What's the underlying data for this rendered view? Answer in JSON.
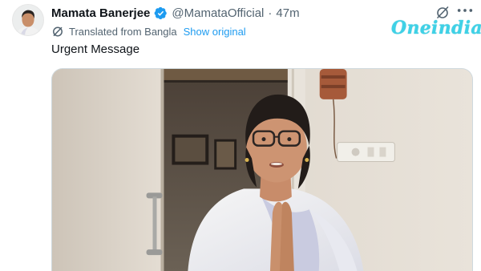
{
  "tweet": {
    "author": {
      "display_name": "Mamata Banerjee",
      "handle": "@MamataOfficial",
      "separator": "·",
      "time": "47m",
      "verified": true,
      "avatar_icon": "profile-photo"
    },
    "translation": {
      "icon": "translate-icon",
      "label": "Translated from Bangla",
      "link": "Show original"
    },
    "text": "Urgent Message",
    "media": {
      "type": "video-still"
    },
    "actions": {
      "grok_icon": "grok-icon",
      "more_icon": "more-options-icon"
    }
  },
  "watermark": {
    "text": "Oneindia"
  },
  "colors": {
    "link": "#1d9bf0",
    "secondary_text": "#536471",
    "verified": "#1d9bf0",
    "watermark": "#3fd1e6"
  }
}
